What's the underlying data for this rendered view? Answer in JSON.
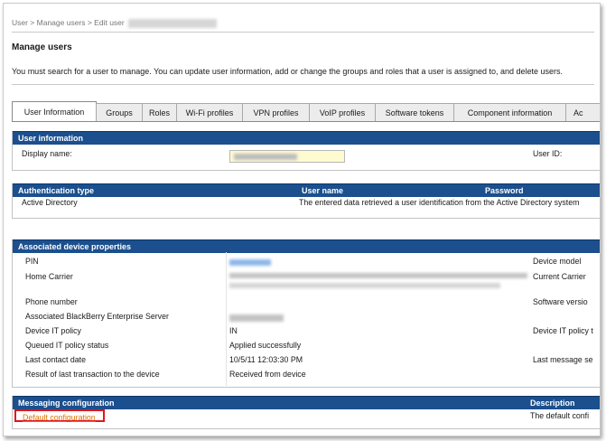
{
  "breadcrumb": {
    "text": "User > Manage users > Edit user"
  },
  "page": {
    "title": "Manage users",
    "intro": "You must search for a user to manage. You can update user information, add or change the groups and roles that a user is assigned to, and delete users."
  },
  "tabs": [
    {
      "label": "User Information",
      "active": true
    },
    {
      "label": "Groups"
    },
    {
      "label": "Roles"
    },
    {
      "label": "Wi-Fi profiles"
    },
    {
      "label": "VPN profiles"
    },
    {
      "label": "VoIP profiles"
    },
    {
      "label": "Software tokens"
    },
    {
      "label": "Component information"
    },
    {
      "label": "Ac"
    }
  ],
  "user_information": {
    "header": "User information",
    "display_name_label": "Display name:",
    "user_id_label": "User ID:"
  },
  "authentication": {
    "headers": {
      "type": "Authentication type",
      "username": "User name",
      "password": "Password"
    },
    "type_value": "Active Directory",
    "message": "The entered data retrieved a user identification from the Active Directory system"
  },
  "device_properties": {
    "header": "Associated device properties",
    "rows": [
      {
        "label": "PIN",
        "value": ""
      },
      {
        "label": "Home Carrier",
        "value": ""
      },
      {
        "label": "Phone number",
        "value": ""
      },
      {
        "label": "Associated BlackBerry Enterprise Server",
        "value": ""
      },
      {
        "label": "Device IT policy",
        "value": "IN"
      },
      {
        "label": "Queued IT policy status",
        "value": "Applied successfully"
      },
      {
        "label": "Last contact date",
        "value": "10/5/11 12:03:30 PM"
      },
      {
        "label": "Result of last transaction to the device",
        "value": "Received from device"
      }
    ],
    "right_labels": [
      "Device model",
      "Current Carrier",
      "Software versio",
      "Device IT policy t",
      "Last message se"
    ]
  },
  "messaging": {
    "header": "Messaging configuration",
    "description_header": "Description",
    "link": "Default configuration",
    "description": "The default confi"
  },
  "colors": {
    "header_blue": "#1b4f8d",
    "link_orange": "#d97500",
    "highlight_red": "#e3141b",
    "input_yellow": "#fffbd0"
  }
}
